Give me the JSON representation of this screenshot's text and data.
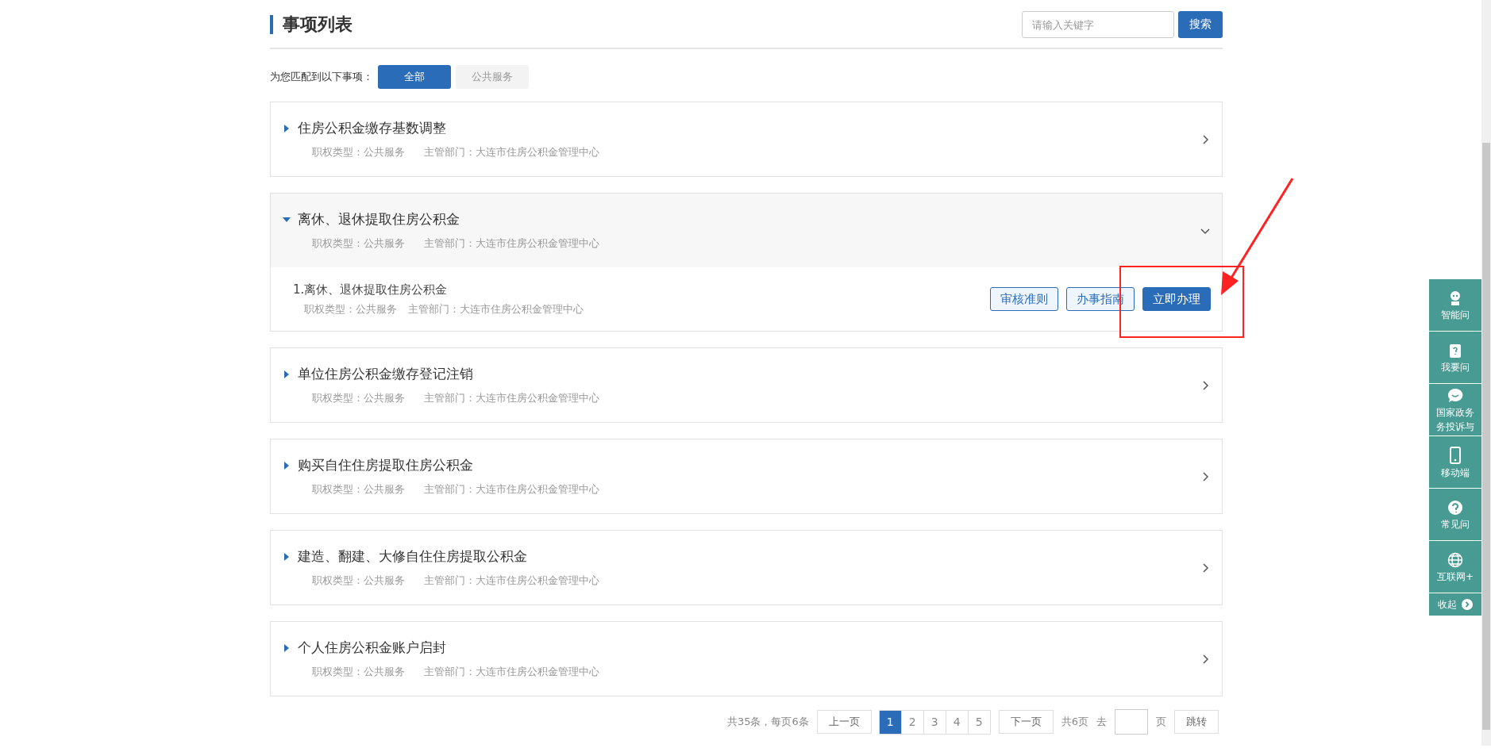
{
  "header": {
    "title": "事项列表",
    "search": {
      "placeholder": "请输入关键字",
      "button": "搜索"
    }
  },
  "filter": {
    "label": "为您匹配到以下事项：",
    "tabs": [
      {
        "label": "全部",
        "selected": true
      },
      {
        "label": "公共服务",
        "selected": false
      }
    ]
  },
  "items": [
    {
      "title": "住房公积金缴存基数调整",
      "type": "职权类型：公共服务",
      "dept": "主管部门：大连市住房公积金管理中心",
      "expanded": false
    },
    {
      "title": "离休、退休提取住房公积金",
      "type": "职权类型：公共服务",
      "dept": "主管部门：大连市住房公积金管理中心",
      "expanded": true,
      "children": [
        {
          "title": "1.离休、退休提取住房公积金",
          "type": "职权类型：公共服务",
          "dept": "主管部门：大连市住房公积金管理中心",
          "buttons": [
            {
              "label": "审核准则",
              "kind": "outline"
            },
            {
              "label": "办事指南",
              "kind": "outline"
            },
            {
              "label": "立即办理",
              "kind": "primary"
            }
          ]
        }
      ]
    },
    {
      "title": "单位住房公积金缴存登记注销",
      "type": "职权类型：公共服务",
      "dept": "主管部门：大连市住房公积金管理中心",
      "expanded": false
    },
    {
      "title": "购买自住住房提取住房公积金",
      "type": "职权类型：公共服务",
      "dept": "主管部门：大连市住房公积金管理中心",
      "expanded": false
    },
    {
      "title": "建造、翻建、大修自住住房提取公积金",
      "type": "职权类型：公共服务",
      "dept": "主管部门：大连市住房公积金管理中心",
      "expanded": false
    },
    {
      "title": "个人住房公积金账户启封",
      "type": "职权类型：公共服务",
      "dept": "主管部门：大连市住房公积金管理中心",
      "expanded": false
    }
  ],
  "pagination": {
    "summary": "共35条，每页6条",
    "prev": "上一页",
    "pages": [
      {
        "label": "1",
        "selected": true
      },
      {
        "label": "2",
        "selected": false
      },
      {
        "label": "3",
        "selected": false
      },
      {
        "label": "4",
        "selected": false
      },
      {
        "label": "5",
        "selected": false
      }
    ],
    "next": "下一页",
    "total": "共6页",
    "goto": "去",
    "unit": "页",
    "jump": "跳转"
  },
  "sidebar": [
    {
      "lines": [
        "智能问"
      ]
    },
    {
      "lines": [
        "我要问"
      ]
    },
    {
      "lines": [
        "国家政务",
        "务投诉与"
      ]
    },
    {
      "lines": [
        "移动端"
      ]
    },
    {
      "lines": [
        "常见问"
      ]
    },
    {
      "lines": [
        "互联网+"
      ]
    }
  ],
  "collapse": "收起"
}
